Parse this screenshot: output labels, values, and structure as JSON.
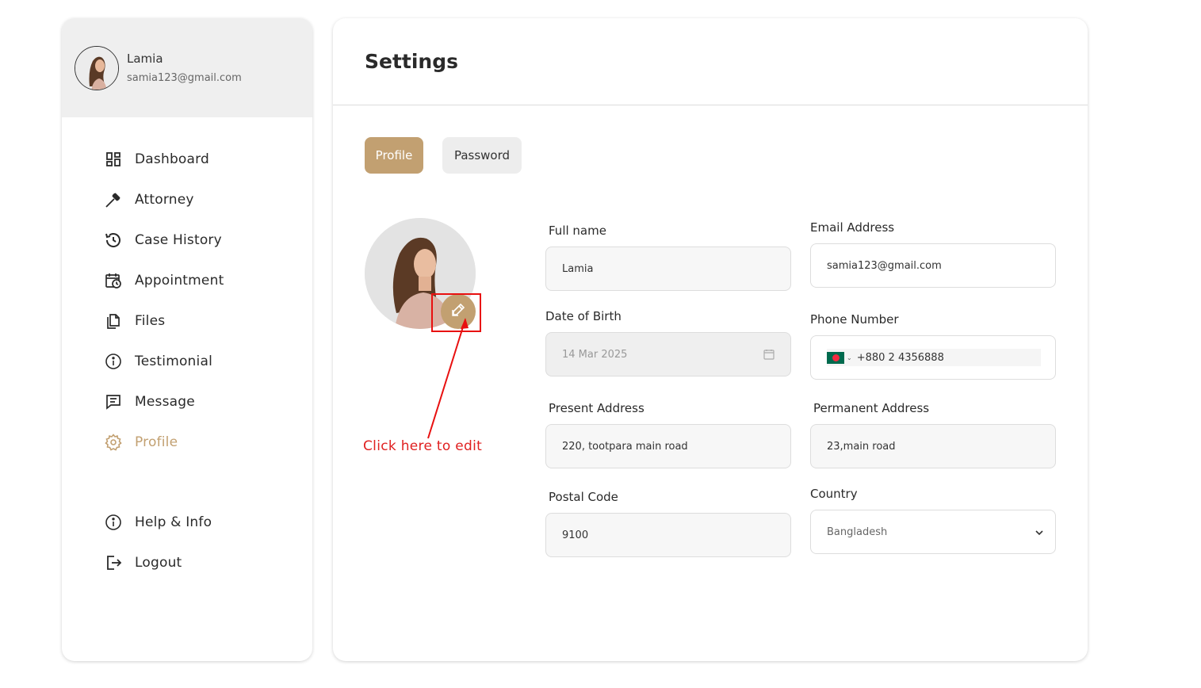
{
  "user": {
    "name": "Lamia",
    "email": "samia123@gmail.com"
  },
  "nav": {
    "items": [
      {
        "label": "Dashboard",
        "icon": "dashboard-icon"
      },
      {
        "label": "Attorney",
        "icon": "gavel-icon"
      },
      {
        "label": "Case History",
        "icon": "history-icon"
      },
      {
        "label": "Appointment",
        "icon": "calendar-clock-icon"
      },
      {
        "label": "Files",
        "icon": "files-icon"
      },
      {
        "label": "Testimonial",
        "icon": "info-icon"
      },
      {
        "label": "Message",
        "icon": "message-icon"
      },
      {
        "label": "Profile",
        "icon": "gear-icon",
        "active": true
      },
      {
        "label": "Help & Info",
        "icon": "info-icon"
      },
      {
        "label": "Logout",
        "icon": "logout-icon"
      }
    ]
  },
  "page": {
    "title": "Settings"
  },
  "tabs": [
    {
      "label": "Profile",
      "active": true
    },
    {
      "label": "Password",
      "active": false
    }
  ],
  "annotation": {
    "text": "Click here to edit"
  },
  "form": {
    "full_name": {
      "label": "Full name",
      "value": "Lamia"
    },
    "email": {
      "label": "Email Address",
      "value": "samia123@gmail.com"
    },
    "dob": {
      "label": "Date of Birth",
      "value": "14 Mar 2025"
    },
    "phone": {
      "label": "Phone Number",
      "value": "+880 2 4356888"
    },
    "present_address": {
      "label": "Present Address",
      "value": "220, tootpara main road"
    },
    "permanent_address": {
      "label": "Permanent Address",
      "value": "23,main road"
    },
    "postal_code": {
      "label": "Postal Code",
      "value": "9100"
    },
    "country": {
      "label": "Country",
      "value": "Bangladesh"
    }
  },
  "colors": {
    "accent": "#c2a071",
    "annotation": "#e81010"
  }
}
